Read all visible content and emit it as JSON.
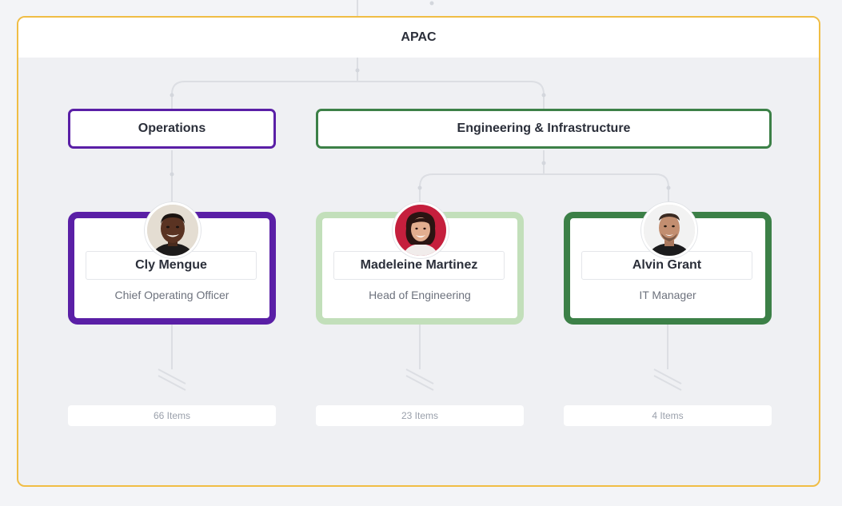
{
  "group": {
    "title": "APAC",
    "border_color": "#f0bd45"
  },
  "departments": [
    {
      "label": "Operations",
      "color": "#5a1fa6"
    },
    {
      "label": "Engineering & Infrastructure",
      "color": "#3c8047"
    }
  ],
  "people": [
    {
      "name": "Cly Mengue",
      "title": "Chief Operating Officer",
      "card_color": "#5a1fa6",
      "items": "66 Items"
    },
    {
      "name": "Madeleine Martinez",
      "title": "Head of Engineering",
      "card_color": "#c2dfba",
      "items": "23 Items"
    },
    {
      "name": "Alvin Grant",
      "title": "IT Manager",
      "card_color": "#3c8047",
      "items": "4 Items"
    }
  ]
}
